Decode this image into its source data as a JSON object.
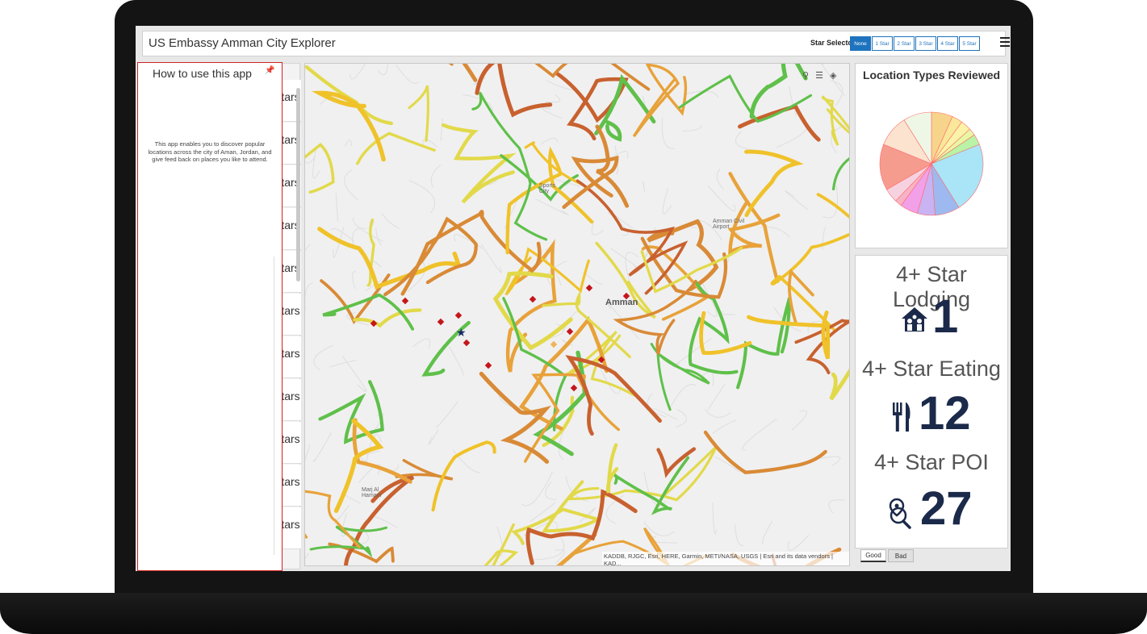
{
  "header": {
    "title": "US Embassy Amman City Explorer",
    "star_selector_label": "Star Selector",
    "star_buttons": [
      "None",
      "1 Star",
      "2 Star",
      "3 Star",
      "4 Star",
      "5 Star"
    ],
    "active_star": "None"
  },
  "left_list": {
    "item_label": "Stars"
  },
  "howto": {
    "title": "How to use this app",
    "text": "This app enables you to discover popular locations across the city of Aman, Jordan, and give feed back on places you like to attend."
  },
  "map": {
    "attribution": "KADDB, RJGC, Esri, HERE, Garmin, METI/NASA, USGS | Esri and its data vendors | KAD...",
    "labels": {
      "city": "Amman",
      "airport": "Amman Civil Airport",
      "sports": "Sports City",
      "marj": "Marj Al Hamam"
    },
    "tools": [
      "search-icon",
      "list-icon",
      "layers-icon"
    ]
  },
  "pie": {
    "title": "Location Types Reviewed",
    "chart_data": {
      "type": "pie",
      "values": [
        6,
        3,
        3,
        2,
        3,
        20,
        7,
        5,
        5,
        2,
        4,
        13,
        9,
        8
      ],
      "colors": [
        "#f7d48c",
        "#f9e79a",
        "#fbf3a8",
        "#e8f7a4",
        "#b9f3a6",
        "#a9e4f7",
        "#9db9ef",
        "#c9b3f2",
        "#f2a0e8",
        "#f7b3c6",
        "#f6d2e0",
        "#f59c8f",
        "#fbe3cf",
        "#eef7e6"
      ]
    }
  },
  "stats": [
    {
      "label": "4+ Star Lodging",
      "value": "1",
      "icon": "lodging-icon"
    },
    {
      "label": "4+ Star Eating",
      "value": "12",
      "icon": "utensils-icon"
    },
    {
      "label": "4+ Star POI",
      "value": "27",
      "icon": "poi-icon"
    }
  ],
  "tabs": [
    "Good",
    "Bad"
  ]
}
